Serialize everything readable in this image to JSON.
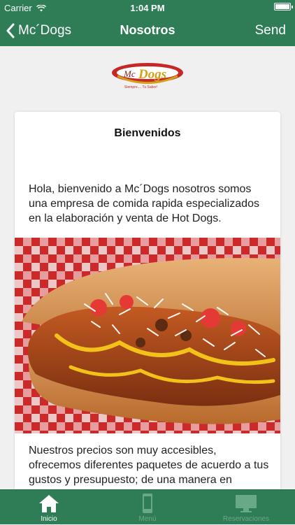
{
  "status_bar": {
    "carrier": "Carrier",
    "time": "1:04 PM"
  },
  "nav": {
    "back_label": "Mc´Dogs",
    "title": "Nosotros",
    "send_label": "Send"
  },
  "logo": {
    "brand": "McDogs",
    "tagline": "Siempre.... Tu Sabor!"
  },
  "card": {
    "title": "Bienvenidos",
    "paragraph1": "Hola, bienvenido a Mc´Dogs nosotros somos una empresa de comida rapida especializados en la elaboración y venta de Hot Dogs.",
    "paragraph2": "Nuestros precios son muy accesibles, ofrecemos diferentes paquetes de acuerdo a tus gustos y presupuesto; de una manera en"
  },
  "tabs": [
    {
      "label": "Inicio",
      "icon": "home-icon",
      "active": true
    },
    {
      "label": "Menú",
      "icon": "phone-icon",
      "active": false
    },
    {
      "label": "Reservaciones",
      "icon": "monitor-icon",
      "active": false
    }
  ],
  "colors": {
    "bar": "#2e7d57",
    "tab_inactive": "#6aa88a",
    "logo_red": "#c62828",
    "logo_gold": "#d4a017"
  }
}
